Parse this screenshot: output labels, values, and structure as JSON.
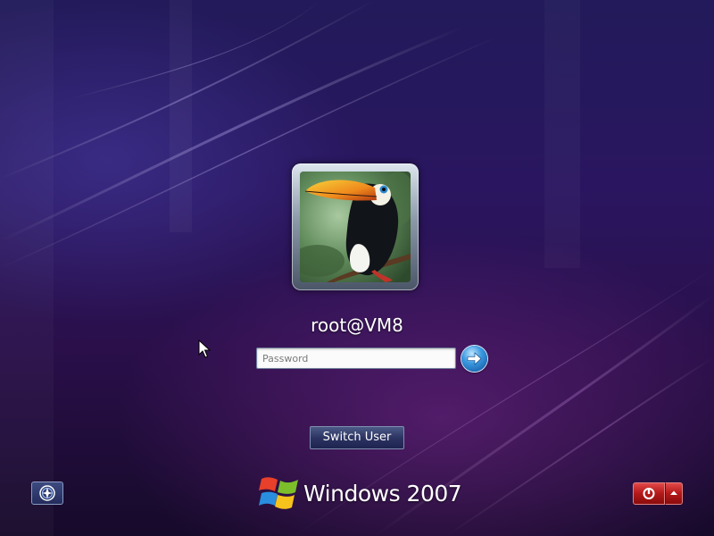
{
  "user": {
    "name": "root@VM8"
  },
  "password_field": {
    "placeholder": "Password",
    "value": ""
  },
  "buttons": {
    "switch_user_label": "Switch User",
    "submit_icon": "arrow-right-icon",
    "ease_of_access_icon": "ease-of-access-icon",
    "power_icon": "power-icon",
    "power_menu_icon": "triangle-up-icon"
  },
  "branding": {
    "product_name": "Windows 2007"
  },
  "colors": {
    "background": "#2a1660",
    "power_button": "#c42222",
    "go_button": "#3b9ae0"
  }
}
